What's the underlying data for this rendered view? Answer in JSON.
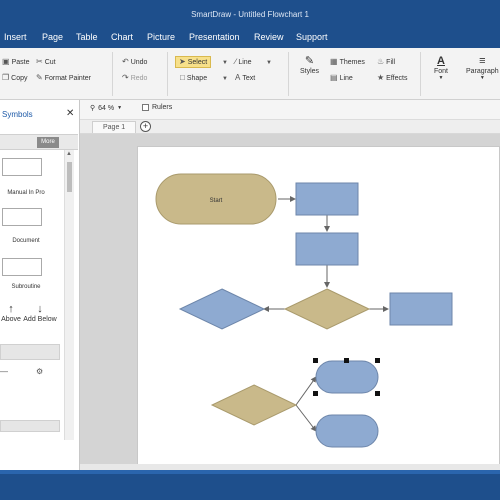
{
  "window": {
    "title": "SmartDraw - Untitled Flowchart 1"
  },
  "menu": {
    "items": [
      "Insert",
      "Page",
      "Table",
      "Chart",
      "Picture",
      "Presentation",
      "Review",
      "Support"
    ]
  },
  "ribbon": {
    "paste": "Paste",
    "cut": "Cut",
    "copy": "Copy",
    "format_painter": "Format Painter",
    "undo": "Undo",
    "redo": "Redo",
    "select": "Select",
    "line": "Line",
    "shape": "Shape",
    "text": "Text",
    "styles": "Styles",
    "themes": "Themes",
    "line_style": "Line",
    "fill": "Fill",
    "effects": "Effects",
    "font": "Font",
    "paragraph": "Paragraph"
  },
  "toolbar": {
    "zoom": "64 %",
    "rulers": "Rulers"
  },
  "pages": {
    "tab": "Page 1",
    "add": "+"
  },
  "left_panel": {
    "title": "Symbols",
    "more": "More",
    "shapes": [
      "Manual In Pro",
      "Document",
      "Subroutine"
    ],
    "actions": [
      "Above",
      "Add Below"
    ]
  },
  "diagram": {
    "start_label": "Start",
    "colors": {
      "process": "#8eaad1",
      "decision": "#c9b98a",
      "terminator": "#c9b98a",
      "stroke": "#6d86aa",
      "connector": "#666666"
    }
  }
}
